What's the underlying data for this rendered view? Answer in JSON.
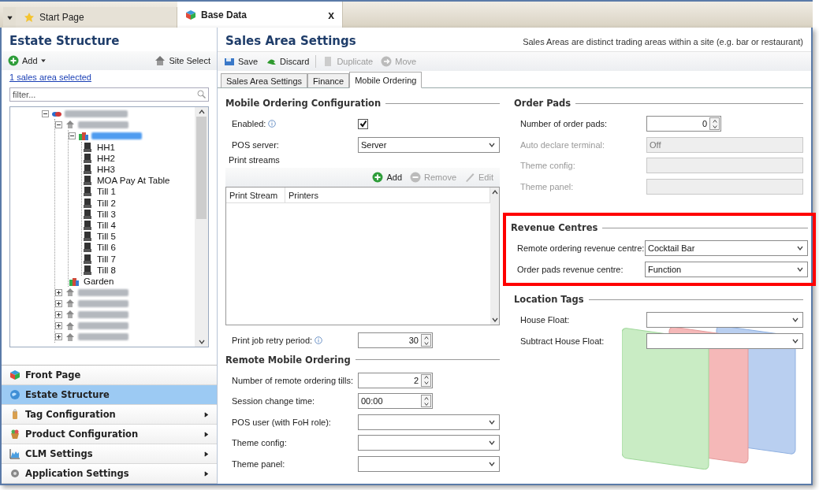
{
  "doc_tabs": [
    {
      "label": "Start Page",
      "selected": false,
      "kind": "star"
    },
    {
      "label": "Base Data",
      "selected": true,
      "kind": "cube"
    }
  ],
  "close_label": "x",
  "left": {
    "title": "Estate Structure",
    "add": "Add",
    "site_select": "Site Select",
    "selection_link": "1 sales area selected",
    "filter": {
      "placeholder": "filter..."
    },
    "tree": [
      {
        "kind": "estate",
        "blurred": true,
        "expanded": true,
        "selected": false,
        "children": [
          {
            "kind": "site",
            "blurred": true,
            "expanded": true,
            "selected": false,
            "children": [
              {
                "kind": "area",
                "blurred": true,
                "expanded": true,
                "selected": true,
                "children": [
                  {
                    "kind": "terminal",
                    "label": "HH1",
                    "selected": false
                  },
                  {
                    "kind": "terminal",
                    "label": "HH2",
                    "selected": false
                  },
                  {
                    "kind": "terminal",
                    "label": "HH3",
                    "selected": false
                  },
                  {
                    "kind": "terminal",
                    "label": "MOA Pay At Table",
                    "selected": false
                  },
                  {
                    "kind": "terminal",
                    "label": "Till 1",
                    "selected": false
                  },
                  {
                    "kind": "terminal",
                    "label": "Till 2",
                    "selected": false
                  },
                  {
                    "kind": "terminal",
                    "label": "Till 3",
                    "selected": false
                  },
                  {
                    "kind": "terminal",
                    "label": "Till 4",
                    "selected": false
                  },
                  {
                    "kind": "terminal",
                    "label": "Till 5",
                    "selected": false
                  },
                  {
                    "kind": "terminal",
                    "label": "Till 6",
                    "selected": false
                  },
                  {
                    "kind": "terminal",
                    "label": "Till 7",
                    "selected": false
                  },
                  {
                    "kind": "terminal",
                    "label": "Till 8",
                    "selected": false
                  }
                ]
              },
              {
                "kind": "area",
                "label": "Garden",
                "selected": false
              }
            ]
          },
          {
            "kind": "site",
            "blurred": true,
            "expanded": false,
            "selected": false
          },
          {
            "kind": "site",
            "blurred": true,
            "expanded": false,
            "selected": false
          },
          {
            "kind": "site",
            "blurred": true,
            "expanded": false,
            "selected": false
          },
          {
            "kind": "site",
            "blurred": true,
            "expanded": false,
            "selected": false
          },
          {
            "kind": "site",
            "blurred": true,
            "expanded": false,
            "selected": false
          }
        ]
      }
    ],
    "nav": [
      {
        "label": "Front Page",
        "kind": "front",
        "selected": false,
        "submenu": false
      },
      {
        "label": "Estate Structure",
        "kind": "globe",
        "selected": true,
        "submenu": false
      },
      {
        "label": "Tag Configuration",
        "kind": "tag",
        "selected": false,
        "submenu": true
      },
      {
        "label": "Product Configuration",
        "kind": "product",
        "selected": false,
        "submenu": true
      },
      {
        "label": "CLM Settings",
        "kind": "chart",
        "selected": false,
        "submenu": true
      },
      {
        "label": "Application Settings",
        "kind": "gear",
        "selected": false,
        "submenu": true
      }
    ]
  },
  "right": {
    "title": "Sales Area Settings",
    "description": "Sales Areas are distinct trading areas within a site (e.g. bar or restaurant)",
    "toolbar": [
      {
        "label": "Save",
        "kind": "save",
        "disabled": false
      },
      {
        "label": "Discard",
        "kind": "discard",
        "disabled": false
      },
      {
        "label": "Duplicate",
        "kind": "duplicate",
        "disabled": true
      },
      {
        "label": "Move",
        "kind": "move",
        "disabled": true
      }
    ],
    "tabs": [
      {
        "label": "Sales Area Settings",
        "selected": false
      },
      {
        "label": "Finance",
        "selected": false
      },
      {
        "label": "Mobile Ordering",
        "selected": true
      }
    ],
    "mobile_config": {
      "title": "Mobile Ordering Configuration",
      "fields": [
        {
          "label": "Enabled:",
          "kind": "checkbox",
          "checked": true,
          "info": true
        },
        {
          "label": "POS server:",
          "kind": "select",
          "value": "Server",
          "info": false
        }
      ],
      "print_streams": {
        "label": "Print streams",
        "actions": [
          {
            "label": "Add",
            "kind": "add",
            "disabled": false
          },
          {
            "label": "Remove",
            "kind": "remove",
            "disabled": true
          },
          {
            "label": "Edit",
            "kind": "edit",
            "disabled": true
          }
        ],
        "columns": [
          "Print Stream",
          "Printers"
        ]
      },
      "retry": {
        "label": "Print job retry period:",
        "kind": "spin",
        "value": "30",
        "info": true
      }
    },
    "remote": {
      "title": "Remote Mobile Ordering",
      "fields": [
        {
          "label": "Number of remote ordering tills:",
          "kind": "spin",
          "value": "2",
          "info": false
        },
        {
          "label": "Session change time:",
          "kind": "time",
          "value": "00:00",
          "info": false
        },
        {
          "label": "POS user (with FoH role):",
          "kind": "select",
          "info": false
        },
        {
          "label": "Theme config:",
          "kind": "select",
          "info": false
        },
        {
          "label": "Theme panel:",
          "kind": "select",
          "info": false
        }
      ]
    },
    "groups": [
      {
        "title": "Order Pads",
        "highlighted": false,
        "fields": [
          {
            "label": "Number of order pads:",
            "kind": "spin",
            "value": "0",
            "disabled": false
          },
          {
            "label": "Auto declare terminal:",
            "kind": "text",
            "value": "Off",
            "disabled": true
          },
          {
            "label": "Theme config:",
            "kind": "text",
            "disabled": true
          },
          {
            "label": "Theme panel:",
            "kind": "text",
            "disabled": true
          }
        ]
      },
      {
        "title": "Revenue Centres",
        "highlighted": true,
        "fields": [
          {
            "label": "Remote ordering revenue centre:",
            "kind": "select",
            "value": "Cocktail Bar",
            "disabled": false
          },
          {
            "label": "Order pads revenue centre:",
            "kind": "select",
            "value": "Function",
            "disabled": false
          }
        ]
      },
      {
        "title": "Location Tags",
        "highlighted": false,
        "fields": [
          {
            "label": "House Float:",
            "kind": "select",
            "disabled": false
          },
          {
            "label": "Subtract House Float:",
            "kind": "select",
            "disabled": false
          }
        ]
      }
    ]
  }
}
